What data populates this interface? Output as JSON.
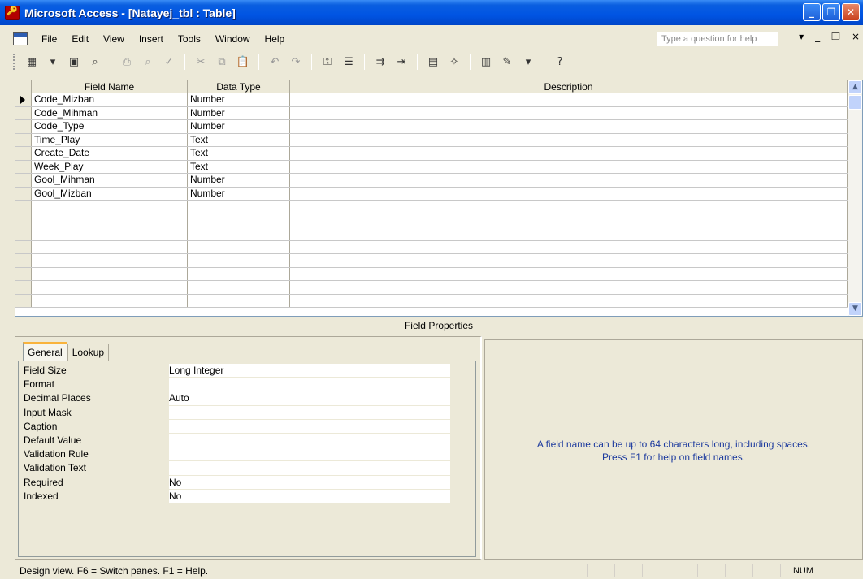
{
  "window": {
    "title": "Microsoft Access - [Natayej_tbl : Table]",
    "buttons": {
      "minimize": "_",
      "restore": "❐",
      "close": "✕"
    }
  },
  "menu": {
    "items": [
      "File",
      "Edit",
      "View",
      "Insert",
      "Tools",
      "Window",
      "Help"
    ],
    "help_box_placeholder": "Type a question for help",
    "right_controls": [
      "▾",
      "_",
      "❐",
      "×"
    ]
  },
  "toolbar": {
    "icons": [
      "view-icon",
      "dropdown-icon",
      "save-icon",
      "search-icon",
      "print-icon",
      "print-preview-icon",
      "spelling-icon",
      "cut-icon",
      "copy-icon",
      "paste-icon",
      "undo-icon",
      "redo-icon",
      "primary-key-icon",
      "indexes-icon",
      "insert-rows-icon",
      "delete-rows-icon",
      "properties-icon",
      "build-icon",
      "database-window-icon",
      "new-object-icon",
      "help-icon"
    ]
  },
  "grid": {
    "headers": {
      "field_name": "Field Name",
      "data_type": "Data Type",
      "description": "Description"
    },
    "rows": [
      {
        "field_name": "Code_Mizban",
        "data_type": "Number",
        "description": ""
      },
      {
        "field_name": "Code_Mihman",
        "data_type": "Number",
        "description": ""
      },
      {
        "field_name": "Code_Type",
        "data_type": "Number",
        "description": ""
      },
      {
        "field_name": "Time_Play",
        "data_type": "Text",
        "description": ""
      },
      {
        "field_name": "Create_Date",
        "data_type": "Text",
        "description": ""
      },
      {
        "field_name": "Week_Play",
        "data_type": "Text",
        "description": ""
      },
      {
        "field_name": "Gool_Mihman",
        "data_type": "Number",
        "description": ""
      },
      {
        "field_name": "Gool_Mizban",
        "data_type": "Number",
        "description": ""
      },
      {
        "field_name": "",
        "data_type": "",
        "description": ""
      },
      {
        "field_name": "",
        "data_type": "",
        "description": ""
      },
      {
        "field_name": "",
        "data_type": "",
        "description": ""
      },
      {
        "field_name": "",
        "data_type": "",
        "description": ""
      },
      {
        "field_name": "",
        "data_type": "",
        "description": ""
      },
      {
        "field_name": "",
        "data_type": "",
        "description": ""
      },
      {
        "field_name": "",
        "data_type": "",
        "description": ""
      },
      {
        "field_name": "",
        "data_type": "",
        "description": ""
      }
    ]
  },
  "field_properties": {
    "title": "Field Properties",
    "tabs": [
      "General",
      "Lookup"
    ],
    "properties": [
      {
        "label": "Field Size",
        "value": "Long Integer"
      },
      {
        "label": "Format",
        "value": ""
      },
      {
        "label": "Decimal Places",
        "value": "Auto"
      },
      {
        "label": "Input Mask",
        "value": ""
      },
      {
        "label": "Caption",
        "value": ""
      },
      {
        "label": "Default Value",
        "value": ""
      },
      {
        "label": "Validation Rule",
        "value": ""
      },
      {
        "label": "Validation Text",
        "value": ""
      },
      {
        "label": "Required",
        "value": "No"
      },
      {
        "label": "Indexed",
        "value": "No"
      }
    ],
    "hint_line1": "A field name can be up to 64 characters long, including spaces.",
    "hint_line2": "Press F1 for help on field names."
  },
  "status": {
    "text": "Design view.  F6 = Switch panes.  F1 = Help.",
    "num": "NUM"
  },
  "colors": {
    "titlebar": "#0054e3",
    "window_bg": "#ece9d8",
    "hint_text": "#1c3a9e"
  }
}
